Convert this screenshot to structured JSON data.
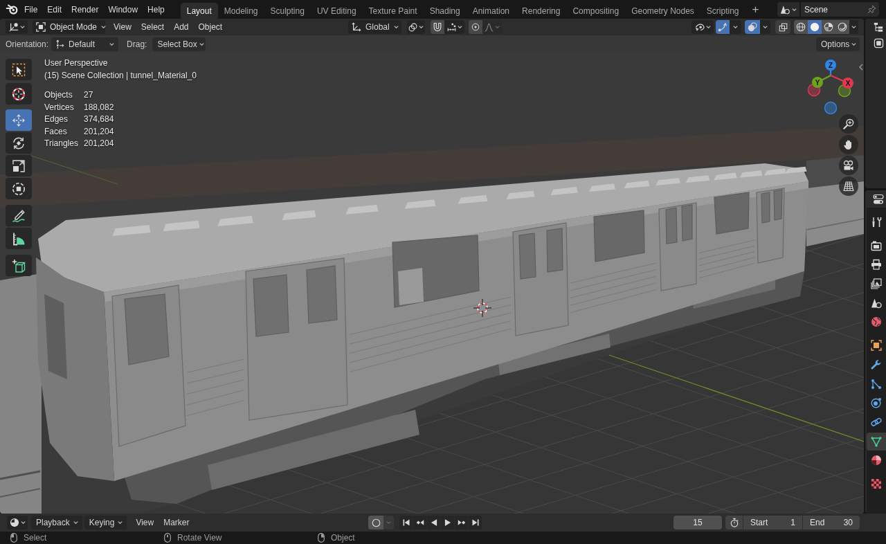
{
  "menu_bar": {
    "menus": [
      "File",
      "Edit",
      "Render",
      "Window",
      "Help"
    ]
  },
  "workspace_tabs": [
    {
      "label": "Layout",
      "selected": true
    },
    {
      "label": "Modeling",
      "selected": false
    },
    {
      "label": "Sculpting",
      "selected": false
    },
    {
      "label": "UV Editing",
      "selected": false
    },
    {
      "label": "Texture Paint",
      "selected": false
    },
    {
      "label": "Shading",
      "selected": false
    },
    {
      "label": "Animation",
      "selected": false
    },
    {
      "label": "Rendering",
      "selected": false
    },
    {
      "label": "Compositing",
      "selected": false
    },
    {
      "label": "Geometry Nodes",
      "selected": false
    },
    {
      "label": "Scripting",
      "selected": false
    }
  ],
  "add_workspace_button": "+",
  "scene_selector": {
    "value": "Scene"
  },
  "viewport_header": {
    "mode": "Object Mode",
    "menus": [
      "View",
      "Select",
      "Add",
      "Object"
    ],
    "orientation": "Global",
    "snap": false,
    "proportional_editing": false,
    "show_gizmos": true,
    "show_overlays": true,
    "xray": false,
    "shading": [
      {
        "kind": "wireframe",
        "selected": false
      },
      {
        "kind": "solid",
        "selected": true
      },
      {
        "kind": "material",
        "selected": false
      },
      {
        "kind": "rendered",
        "selected": false
      }
    ]
  },
  "tool_settings": {
    "orientation_label": "Orientation:",
    "orientation": "Default",
    "drag_label": "Drag:",
    "drag": "Select Box",
    "options": "Options"
  },
  "toolbar": [
    {
      "kind": "select_box",
      "selected": false
    },
    {
      "kind": "cursor",
      "selected": false
    },
    {
      "kind": "move",
      "selected": true
    },
    {
      "kind": "rotate",
      "selected": false
    },
    {
      "kind": "scale",
      "selected": false
    },
    {
      "kind": "transform",
      "selected": false
    },
    {
      "kind": "annotate",
      "selected": false
    },
    {
      "kind": "measure",
      "selected": false
    },
    {
      "kind": "add_cube",
      "selected": false
    }
  ],
  "viewport_info": {
    "view": "User Perspective",
    "collection": "(15) Scene Collection | tunnel_Material_0",
    "statistics": [
      {
        "label": "Objects",
        "value": "27"
      },
      {
        "label": "Vertices",
        "value": "188,082"
      },
      {
        "label": "Edges",
        "value": "374,684"
      },
      {
        "label": "Faces",
        "value": "201,204"
      },
      {
        "label": "Triangles",
        "value": "201,204"
      }
    ]
  },
  "navigation_gizmo": {
    "axes": [
      {
        "label": "Z",
        "color": "#2e86e8"
      },
      {
        "label": "Y",
        "color": "#6fa31f"
      },
      {
        "label": "X",
        "color": "#e0384f"
      }
    ]
  },
  "navigation_buttons": [
    {
      "kind": "zoom"
    },
    {
      "kind": "pan"
    },
    {
      "kind": "camera"
    },
    {
      "kind": "perspective"
    }
  ],
  "properties_tabs": [
    {
      "kind": "tool",
      "selected": false
    },
    {
      "kind": "render",
      "selected": false
    },
    {
      "kind": "output",
      "selected": false
    },
    {
      "kind": "view_layer",
      "selected": false
    },
    {
      "kind": "scene",
      "selected": false
    },
    {
      "kind": "world",
      "selected": false
    },
    {
      "kind": "object",
      "selected": false
    },
    {
      "kind": "modifiers",
      "selected": false
    },
    {
      "kind": "particles",
      "selected": false
    },
    {
      "kind": "physics",
      "selected": false
    },
    {
      "kind": "constraints",
      "selected": false
    },
    {
      "kind": "data",
      "selected": true
    },
    {
      "kind": "material",
      "selected": false
    },
    {
      "kind": "texture",
      "selected": false
    }
  ],
  "timeline": {
    "menus": [
      {
        "label": "Playback",
        "dropdown": true
      },
      {
        "label": "Keying",
        "dropdown": true
      },
      {
        "label": "View",
        "dropdown": false
      },
      {
        "label": "Marker",
        "dropdown": false
      }
    ],
    "auto_keying": false,
    "playback_buttons": [
      {
        "kind": "jump_start"
      },
      {
        "kind": "prev_keyframe"
      },
      {
        "kind": "play_reverse"
      },
      {
        "kind": "play"
      },
      {
        "kind": "next_keyframe"
      },
      {
        "kind": "jump_end"
      }
    ],
    "current_frame": "15",
    "start_label": "Start",
    "start": "1",
    "end_label": "End",
    "end": "30"
  },
  "status_bar": [
    {
      "kind": "left_click",
      "label": "Select"
    },
    {
      "kind": "middle_click",
      "label": "Rotate View"
    },
    {
      "kind": "right_click",
      "label": "Object"
    }
  ]
}
